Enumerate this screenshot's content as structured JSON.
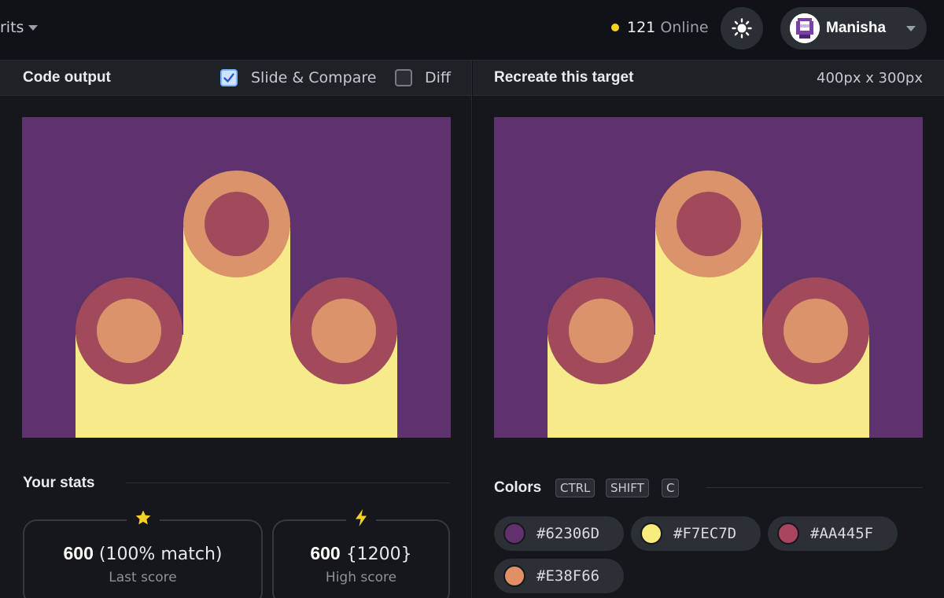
{
  "topbar": {
    "nav_partial_label": "rits",
    "online_count": "121",
    "online_label": "Online",
    "user_name": "Manisha"
  },
  "output_panel": {
    "title": "Code output",
    "slide_compare_label": "Slide & Compare",
    "slide_compare_checked": true,
    "diff_label": "Diff",
    "diff_checked": false
  },
  "target_panel": {
    "title": "Recreate this target",
    "dimensions": "400px x 300px"
  },
  "stats": {
    "title": "Your stats",
    "last_score": {
      "score": "600",
      "detail": "(100% match)",
      "label": "Last score"
    },
    "high_score": {
      "score": "600",
      "detail": "{1200}",
      "label": "High score"
    }
  },
  "colors": {
    "title": "Colors",
    "shortcut_keys": [
      "CTRL",
      "SHIFT",
      "C"
    ],
    "swatches": [
      {
        "hex": "#62306D"
      },
      {
        "hex": "#F7EC7D"
      },
      {
        "hex": "#AA445F"
      },
      {
        "hex": "#E38F66"
      }
    ]
  },
  "palette": {
    "background": "#5e326c",
    "yellow": "#f6ea8a",
    "rose": "#a14a5c",
    "peach": "#da936a"
  }
}
